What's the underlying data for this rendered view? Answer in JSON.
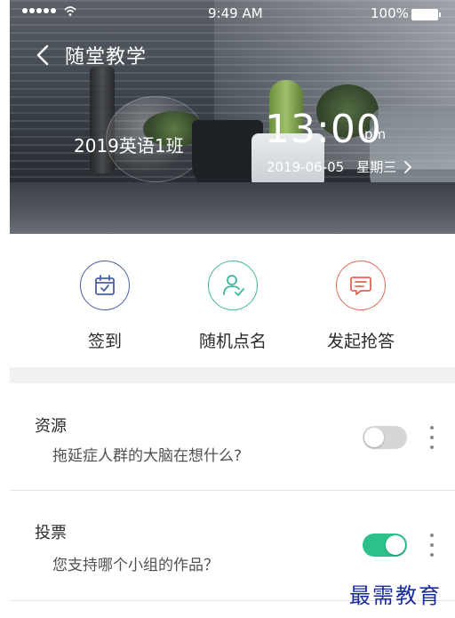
{
  "status_bar": {
    "time": "9:49 AM",
    "battery": "100%"
  },
  "nav": {
    "title": "随堂教学"
  },
  "hero": {
    "class_name": "2019英语1班",
    "time": "13:00",
    "ampm": "pm",
    "date": "2019-06-05",
    "weekday": "星期三"
  },
  "actions": [
    {
      "label": "签到",
      "icon": "calendar-check-icon",
      "color": "#4b5fa8"
    },
    {
      "label": "随机点名",
      "icon": "user-check-icon",
      "color": "#3fb89a"
    },
    {
      "label": "发起抢答",
      "icon": "chat-bubble-icon",
      "color": "#e0675a"
    }
  ],
  "list": [
    {
      "title": "资源",
      "description": "拖延症人群的大脑在想什么?",
      "toggle": "off"
    },
    {
      "title": "投票",
      "description": "您支持哪个小组的作品？",
      "toggle": "on"
    }
  ],
  "colors": {
    "toggle_on": "#2ec08b",
    "toggle_off": "#d6d6d6"
  },
  "watermark": "最需教育"
}
